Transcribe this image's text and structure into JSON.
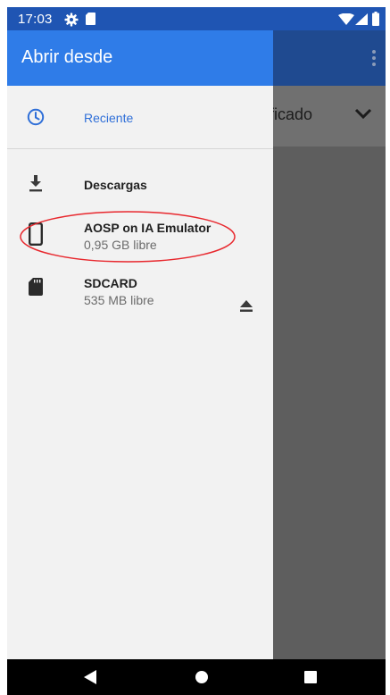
{
  "status_bar": {
    "time": "17:03",
    "icons": [
      "gear-icon",
      "sd-card-icon",
      "wifi-icon",
      "signal-icon",
      "battery-icon"
    ]
  },
  "background_app": {
    "sort_label": "ificado",
    "icons": [
      "more-vert-icon",
      "chevron-down-icon"
    ]
  },
  "drawer": {
    "title": "Abrir desde",
    "recent": {
      "label": "Reciente",
      "icon": "clock-icon"
    },
    "downloads": {
      "label": "Descargas",
      "icon": "download-icon"
    },
    "device": {
      "label": "AOSP on IA Emulator",
      "sublabel": "0,95 GB libre",
      "icon": "phone-icon"
    },
    "sdcard": {
      "label": "SDCARD",
      "sublabel": "535 MB libre",
      "icon": "sd-card-icon",
      "action_icon": "eject-icon"
    }
  },
  "nav_bar": {
    "icons": [
      "back-icon",
      "home-icon",
      "recents-icon"
    ]
  },
  "colors": {
    "status_bar": "#1f55b3",
    "drawer_header": "#2f7ce8",
    "drawer_background": "#f2f2f2",
    "scrim": "#5e5e5e",
    "accent": "#2f6fd8",
    "highlight": "#e8282e"
  }
}
